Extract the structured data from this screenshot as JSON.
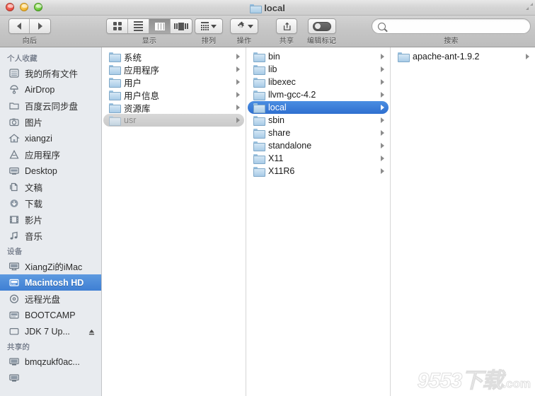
{
  "window": {
    "title": "local",
    "title_icon": "folder-icon",
    "traffic_lights": [
      {
        "name": "close-button",
        "color": "#e8483c"
      },
      {
        "name": "minimize-button",
        "color": "#f0b228"
      },
      {
        "name": "zoom-button",
        "color": "#62c236"
      }
    ],
    "resize_icon": "expand-corner-icon"
  },
  "toolbar": {
    "nav": {
      "label": "向后",
      "back_icon": "chevron-left-icon",
      "forward_icon": "chevron-right-icon"
    },
    "view": {
      "label": "显示",
      "options": [
        {
          "name": "icon-view",
          "icon": "grid-icon",
          "active": false
        },
        {
          "name": "list-view",
          "icon": "list-icon",
          "active": false
        },
        {
          "name": "column-view",
          "icon": "columns-icon",
          "active": true
        },
        {
          "name": "coverflow-view",
          "icon": "coverflow-icon",
          "active": false
        }
      ]
    },
    "arrange": {
      "label": "排列",
      "icon": "arrange-icon"
    },
    "action": {
      "label": "操作",
      "icon": "gear-icon"
    },
    "share": {
      "label": "共享",
      "icon": "share-icon"
    },
    "tags": {
      "label": "编辑标记",
      "icon": "tag-toggle-icon"
    },
    "search": {
      "label": "搜索",
      "placeholder": "",
      "value": "",
      "icon": "search-icon"
    }
  },
  "sidebar": {
    "sections": [
      {
        "header": "个人收藏",
        "items": [
          {
            "label": "我的所有文件",
            "icon": "all-files-icon",
            "selected": false
          },
          {
            "label": "AirDrop",
            "icon": "airdrop-icon",
            "selected": false
          },
          {
            "label": "百度云同步盘",
            "icon": "folder-icon",
            "selected": false
          },
          {
            "label": "图片",
            "icon": "pictures-icon",
            "selected": false
          },
          {
            "label": "xiangzi",
            "icon": "home-icon",
            "selected": false
          },
          {
            "label": "应用程序",
            "icon": "applications-icon",
            "selected": false
          },
          {
            "label": "Desktop",
            "icon": "desktop-icon",
            "selected": false
          },
          {
            "label": "文稿",
            "icon": "documents-icon",
            "selected": false
          },
          {
            "label": "下载",
            "icon": "downloads-icon",
            "selected": false
          },
          {
            "label": "影片",
            "icon": "movies-icon",
            "selected": false
          },
          {
            "label": "音乐",
            "icon": "music-icon",
            "selected": false
          }
        ]
      },
      {
        "header": "设备",
        "items": [
          {
            "label": "XiangZi的iMac",
            "icon": "imac-icon",
            "selected": false
          },
          {
            "label": "Macintosh HD",
            "icon": "harddisk-icon",
            "selected": true
          },
          {
            "label": "远程光盘",
            "icon": "optical-disc-icon",
            "selected": false
          },
          {
            "label": "BOOTCAMP",
            "icon": "harddisk-icon",
            "selected": false
          },
          {
            "label": "JDK 7 Up...",
            "icon": "removable-disk-icon",
            "selected": false,
            "eject": true
          }
        ]
      },
      {
        "header": "共享的",
        "items": [
          {
            "label": "bmqzukf0ac...",
            "icon": "server-icon",
            "selected": false
          },
          {
            "label": "",
            "icon": "server-icon",
            "selected": false
          }
        ]
      }
    ]
  },
  "columns": [
    {
      "name": "column-macintosh-hd",
      "items": [
        {
          "label": "系统",
          "icon": "folder-icon",
          "state": "none",
          "disclosure": true
        },
        {
          "label": "应用程序",
          "icon": "folder-icon",
          "state": "none",
          "disclosure": true
        },
        {
          "label": "用户",
          "icon": "folder-icon",
          "state": "none",
          "disclosure": true
        },
        {
          "label": "用户信息",
          "icon": "folder-alias-icon",
          "state": "none",
          "disclosure": true,
          "alias": true
        },
        {
          "label": "资源库",
          "icon": "folder-icon",
          "state": "none",
          "disclosure": true
        },
        {
          "label": "usr",
          "icon": "folder-icon",
          "state": "inactive",
          "disclosure": true
        }
      ]
    },
    {
      "name": "column-usr",
      "items": [
        {
          "label": "bin",
          "icon": "folder-icon",
          "state": "none",
          "disclosure": true
        },
        {
          "label": "lib",
          "icon": "folder-icon",
          "state": "none",
          "disclosure": true
        },
        {
          "label": "libexec",
          "icon": "folder-icon",
          "state": "none",
          "disclosure": true
        },
        {
          "label": "llvm-gcc-4.2",
          "icon": "folder-icon",
          "state": "none",
          "disclosure": true
        },
        {
          "label": "local",
          "icon": "folder-icon",
          "state": "selected",
          "disclosure": true
        },
        {
          "label": "sbin",
          "icon": "folder-icon",
          "state": "none",
          "disclosure": true
        },
        {
          "label": "share",
          "icon": "folder-icon",
          "state": "none",
          "disclosure": true
        },
        {
          "label": "standalone",
          "icon": "folder-icon",
          "state": "none",
          "disclosure": true
        },
        {
          "label": "X11",
          "icon": "folder-icon",
          "state": "none",
          "disclosure": true
        },
        {
          "label": "X11R6",
          "icon": "folder-alias-icon",
          "state": "none",
          "disclosure": true,
          "alias": true
        }
      ]
    },
    {
      "name": "column-local",
      "items": [
        {
          "label": "apache-ant-1.9.2",
          "icon": "folder-icon",
          "state": "none",
          "disclosure": true
        }
      ]
    }
  ],
  "watermark": {
    "text": "9553",
    "suffix": "下载",
    "domain": ".com"
  },
  "colors": {
    "selection_blue": "#3f7fd3",
    "sidebar_bg": "#e8ebef",
    "toolbar_bg": "#c6c6c6",
    "folder_blue": "#a8cbe7"
  }
}
